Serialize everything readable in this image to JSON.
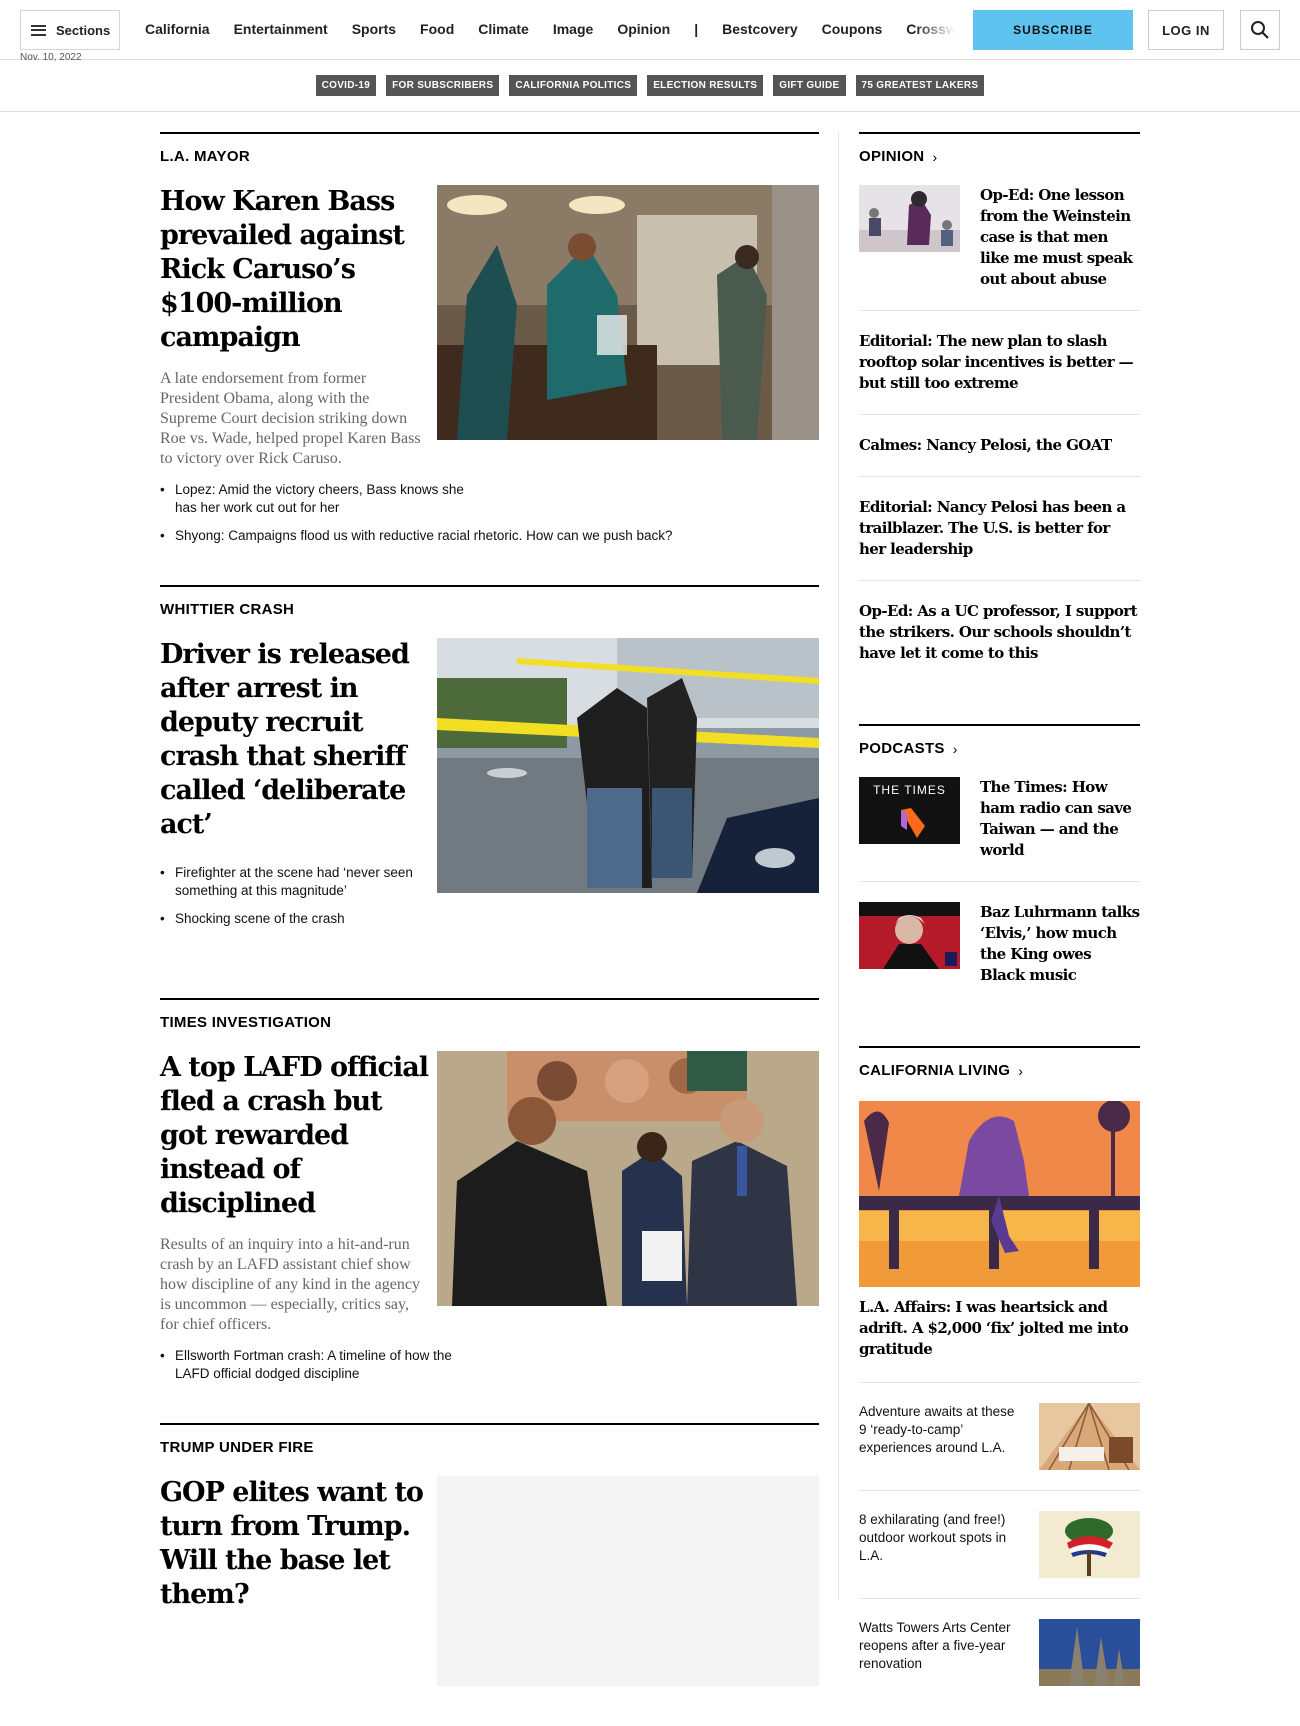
{
  "header": {
    "sections_label": "Sections",
    "nav": [
      "California",
      "Entertainment",
      "Sports",
      "Food",
      "Climate",
      "Image",
      "Opinion",
      "|",
      "Bestcovery",
      "Coupons",
      "Crossword"
    ],
    "subscribe_label": "SUBSCRIBE",
    "login_label": "LOG IN",
    "date_partial": "Nov. 10, 2022"
  },
  "trending": [
    "COVID-19",
    "FOR SUBSCRIBERS",
    "CALIFORNIA POLITICS",
    "ELECTION RESULTS",
    "GIFT GUIDE",
    "75 GREATEST LAKERS"
  ],
  "stories": [
    {
      "kicker": "L.A. Mayor",
      "headline": "How Karen Bass prevailed against Rick Caruso’s $100-million campaign",
      "dek": "A late endorsement from former President Obama, along with the Supreme Court decision striking down Roe vs. Wade, helped propel Karen Bass to victory over Rick Caruso.",
      "related": [
        "Lopez: Amid the victory cheers, Bass knows she has her work cut out for her",
        "Shyong: Campaigns flood us with reductive racial rhetoric. How can we push back?"
      ]
    },
    {
      "kicker": "Whittier Crash",
      "headline": "Driver is released after arrest in deputy recruit crash that sheriff called ‘deliberate act’",
      "dek": "",
      "related": [
        "Firefighter at the scene had ‘never seen something at this magnitude’",
        "Shocking scene of the crash"
      ]
    },
    {
      "kicker": "Times Investigation",
      "headline": "A top LAFD official fled a crash but got rewarded instead of disciplined",
      "dek": "Results of an inquiry into a hit-and-run crash by an LAFD assistant chief show how discipline of any kind in the agency is uncommon — especially, critics say, for chief officers.",
      "related": [
        "Ellsworth Fortman crash: A timeline of how the LAFD official dodged discipline"
      ]
    },
    {
      "kicker": "Trump Under Fire",
      "headline": "GOP elites want to turn from Trump. Will the base let them?",
      "dek": "",
      "related": []
    }
  ],
  "rail": {
    "opinion": {
      "title": "OPINION",
      "items": [
        "Op-Ed: One lesson from the Weinstein case is that men like me must speak out about abuse",
        "Editorial: The new plan to slash rooftop solar incentives is better — but still too extreme",
        "Calmes: Nancy Pelosi, the GOAT",
        "Editorial: Nancy Pelosi has been a trailblazer. The U.S. is better for her leadership",
        "Op-Ed: As a UC professor, I support the strikers. Our schools shouldn’t have let it come to this"
      ]
    },
    "podcasts": {
      "title": "PODCASTS",
      "thumb_label": "THE TIMES",
      "items": [
        "The Times: How ham radio can save Taiwan — and the world",
        "Baz Luhrmann talks ‘Elvis,’ how much the King owes Black music"
      ]
    },
    "california_living": {
      "title": "CALIFORNIA LIVING",
      "lead": "L.A. Affairs: I was heartsick and adrift. A $2,000 ‘fix’ jolted me into gratitude",
      "items": [
        "Adventure awaits at these 9 ‘ready-to-camp’ experiences around L.A.",
        "8 exhilarating (and free!) outdoor workout spots in L.A.",
        "Watts Towers Arts Center reopens after a five-year renovation"
      ]
    }
  },
  "colors": {
    "subscribe_bg": "#5ec4ef",
    "pill_bg": "#555555",
    "dek": "#666666"
  }
}
